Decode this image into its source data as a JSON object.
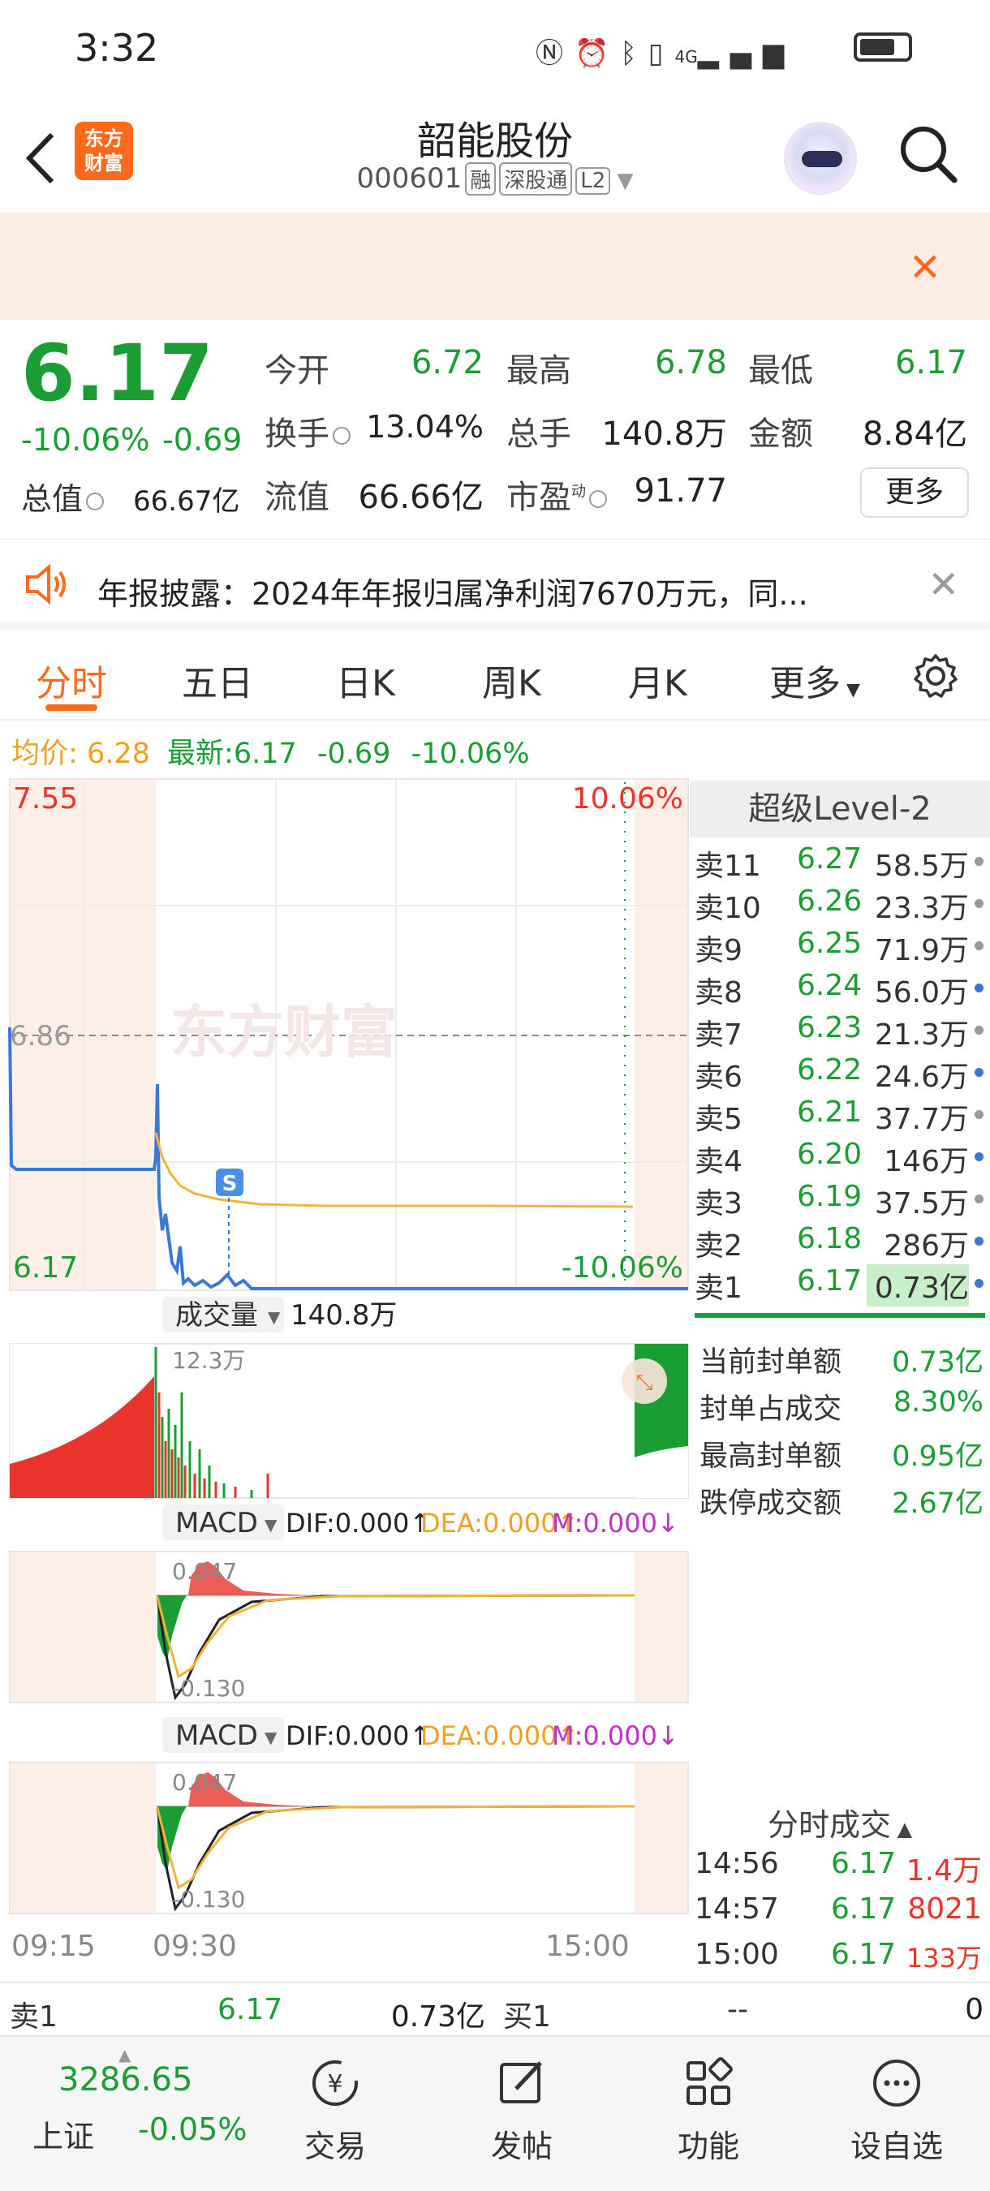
{
  "status_bar": {
    "time": "3:32",
    "network": "4G"
  },
  "header": {
    "back_icon": "chevron-left-icon",
    "logo_text_1": "东方",
    "logo_text_2": "财富",
    "stock_name": "韶能股份",
    "stock_code": "000601",
    "tags": [
      "融",
      "深股通",
      "L2"
    ]
  },
  "quote": {
    "price": "6.17",
    "change_pct": "-10.06%",
    "change": "-0.69",
    "open_label": "今开",
    "open": "6.72",
    "high_label": "最高",
    "high": "6.78",
    "low_label": "最低",
    "low": "6.17",
    "turnover_label": "换手",
    "turnover": "13.04%",
    "volume_label": "总手",
    "volume": "140.8万",
    "amount_label": "金额",
    "amount": "8.84亿",
    "mktcap_label": "总值",
    "mktcap": "66.67亿",
    "float_label": "流值",
    "float": "66.66亿",
    "pe_label": "市盈",
    "pe_sup": "动",
    "pe": "91.77",
    "more_label": "更多"
  },
  "news": {
    "text": "年报披露：2024年年报归属净利润7670万元，同..."
  },
  "tabs": [
    "分时",
    "五日",
    "日K",
    "周K",
    "月K",
    "更多"
  ],
  "price_line": {
    "avg_label": "均价:",
    "avg": "6.28",
    "latest_label": "最新:",
    "latest": "6.17",
    "chg": "-0.69",
    "pct": "-10.06%"
  },
  "chart_labels": {
    "top_price": "7.55",
    "top_pct": "10.06%",
    "mid_price": "6.86",
    "bottom_price": "6.17",
    "bottom_pct": "-10.06%",
    "watermark": "东方财富",
    "s_marker": "S",
    "volume_label": "成交量",
    "volume_value": "140.8万",
    "volume_max": "12.3万",
    "macd_label": "MACD",
    "dif": "DIF:0.000↑",
    "dea": "DEA:0.000↑",
    "m": "M:0.000↓",
    "macd_top": "0.047",
    "macd_bottom": "-0.130",
    "time_start": "09:15",
    "time_open": "09:30",
    "time_close": "15:00"
  },
  "chart_data": {
    "type": "line",
    "x": [
      "09:15",
      "09:30",
      "15:00"
    ],
    "ylim": [
      6.17,
      7.55
    ],
    "reference": 6.86
  },
  "order_book": {
    "title": "超级Level-2",
    "asks": [
      {
        "name": "卖11",
        "price": "6.27",
        "vol": "58.5万",
        "dot": "#999999"
      },
      {
        "name": "卖10",
        "price": "6.26",
        "vol": "23.3万",
        "dot": "#999999"
      },
      {
        "name": "卖9",
        "price": "6.25",
        "vol": "71.9万",
        "dot": "#999999"
      },
      {
        "name": "卖8",
        "price": "6.24",
        "vol": "56.0万",
        "dot": "#3a78d6"
      },
      {
        "name": "卖7",
        "price": "6.23",
        "vol": "21.3万",
        "dot": "#999999"
      },
      {
        "name": "卖6",
        "price": "6.22",
        "vol": "24.6万",
        "dot": "#3a78d6"
      },
      {
        "name": "卖5",
        "price": "6.21",
        "vol": "37.7万",
        "dot": "#999999"
      },
      {
        "name": "卖4",
        "price": "6.20",
        "vol": "146万",
        "dot": "#3a78d6"
      },
      {
        "name": "卖3",
        "price": "6.19",
        "vol": "37.5万",
        "dot": "#999999"
      },
      {
        "name": "卖2",
        "price": "6.18",
        "vol": "286万",
        "dot": "#3a78d6"
      },
      {
        "name": "卖1",
        "price": "6.17",
        "vol": "0.73亿",
        "dot": "#3a78d6"
      }
    ],
    "stats": [
      {
        "label": "当前封单额",
        "value": "0.73亿"
      },
      {
        "label": "封单占成交",
        "value": "8.30%"
      },
      {
        "label": "最高封单额",
        "value": "0.95亿"
      },
      {
        "label": "跌停成交额",
        "value": "2.67亿"
      }
    ],
    "ticks_title": "分时成交",
    "ticks": [
      {
        "time": "14:56",
        "price": "6.17",
        "vol": "1.4万"
      },
      {
        "time": "14:57",
        "price": "6.17",
        "vol": "8021"
      },
      {
        "time": "15:00",
        "price": "6.17",
        "vol": "133万"
      }
    ]
  },
  "sell_buy": {
    "sell_label": "卖1",
    "sell_price": "6.17",
    "sell_vol": "0.73亿",
    "buy_label": "买1",
    "buy_price": "--",
    "buy_vol": "0"
  },
  "bottom_nav": {
    "index_value": "3286.65",
    "index_name": "上证",
    "index_pct": "-0.05%",
    "items": [
      "交易",
      "发帖",
      "功能",
      "设自选"
    ]
  },
  "colors": {
    "up": "#e8342a",
    "down": "#1a9e34",
    "accent": "#ff6a1a",
    "price_line": "#3a78d6",
    "avg_line": "#f0b43c"
  }
}
